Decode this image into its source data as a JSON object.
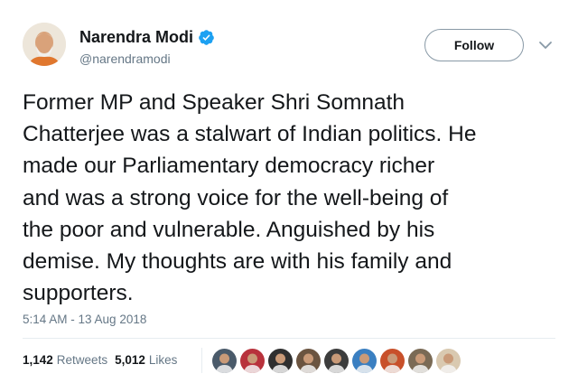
{
  "author": {
    "display_name": "Narendra Modi",
    "handle": "@narendramodi",
    "verified_icon": "verified-badge-icon",
    "avatar_icon": "profile-photo"
  },
  "follow_button": {
    "label": "Follow"
  },
  "menu_icon": "chevron-down-icon",
  "tweet": {
    "lines": [
      "Former MP and Speaker Shri Somnath",
      "Chatterjee was a stalwart of Indian politics. He",
      "made our Parliamentary democracy richer",
      "and was a strong voice for the well-being of",
      "the poor and vulnerable. Anguished by his",
      "demise. My thoughts are with his family and",
      "supporters."
    ],
    "timestamp": "5:14 AM - 13 Aug 2018"
  },
  "stats": {
    "retweets": {
      "count": "1,142",
      "label": "Retweets"
    },
    "likes": {
      "count": "5,012",
      "label": "Likes"
    }
  },
  "likers": [
    {
      "color": "#4a5a6a"
    },
    {
      "color": "#b8323c"
    },
    {
      "color": "#2f2f2f"
    },
    {
      "color": "#6b5440"
    },
    {
      "color": "#3c3c3c"
    },
    {
      "color": "#3a7fc1"
    },
    {
      "color": "#c8502a"
    },
    {
      "color": "#7a6a55"
    },
    {
      "color": "#d9c9b0"
    }
  ],
  "colors": {
    "text_primary": "#14171a",
    "text_secondary": "#657786",
    "verified_blue": "#1da1f2",
    "divider": "#e6ecf0"
  }
}
